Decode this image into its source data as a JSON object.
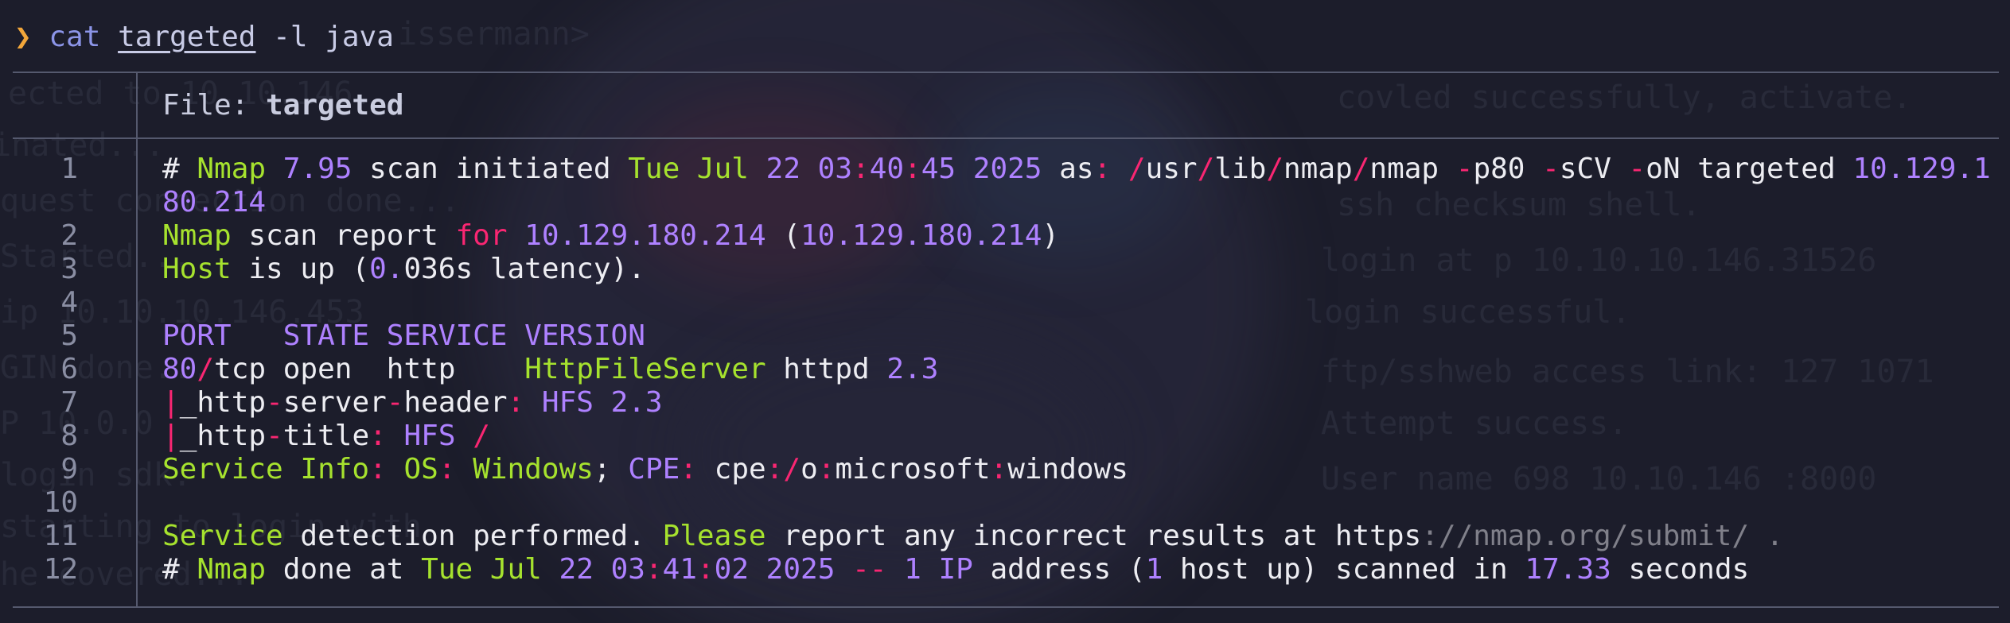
{
  "prompt": {
    "arrow": "❯",
    "command": "cat",
    "file_arg": "targeted",
    "options": "-l java"
  },
  "file_header": {
    "label": "File: ",
    "filename": "targeted"
  },
  "colors": {
    "background": "#1c1d2b",
    "prompt_arrow": "#f2a63a",
    "command": "#8c95e8",
    "plain": "#ededf2",
    "green": "#a6e22e",
    "purple": "#ae81ff",
    "red": "#f92672",
    "grey": "#80808a",
    "rule": "#55596e",
    "line_number": "#8a8ea3"
  },
  "lines": [
    {
      "n": "1",
      "segments": [
        {
          "t": "# ",
          "c": "w"
        },
        {
          "t": "Nmap",
          "c": "g"
        },
        {
          "t": " ",
          "c": "w"
        },
        {
          "t": "7.95",
          "c": "p"
        },
        {
          "t": " scan initiated ",
          "c": "w"
        },
        {
          "t": "Tue Jul",
          "c": "g"
        },
        {
          "t": " ",
          "c": "w"
        },
        {
          "t": "22 03",
          "c": "p"
        },
        {
          "t": ":",
          "c": "r"
        },
        {
          "t": "40",
          "c": "p"
        },
        {
          "t": ":",
          "c": "r"
        },
        {
          "t": "45 2025",
          "c": "p"
        },
        {
          "t": " as",
          "c": "w"
        },
        {
          "t": ":",
          "c": "r"
        },
        {
          "t": " ",
          "c": "w"
        },
        {
          "t": "/",
          "c": "r"
        },
        {
          "t": "usr",
          "c": "w"
        },
        {
          "t": "/",
          "c": "r"
        },
        {
          "t": "lib",
          "c": "w"
        },
        {
          "t": "/",
          "c": "r"
        },
        {
          "t": "nmap",
          "c": "w"
        },
        {
          "t": "/",
          "c": "r"
        },
        {
          "t": "nmap ",
          "c": "w"
        },
        {
          "t": "-",
          "c": "r"
        },
        {
          "t": "p80 ",
          "c": "w"
        },
        {
          "t": "-",
          "c": "r"
        },
        {
          "t": "sCV ",
          "c": "w"
        },
        {
          "t": "-",
          "c": "r"
        },
        {
          "t": "oN targeted ",
          "c": "w"
        },
        {
          "t": "10.129.180.214",
          "c": "p"
        }
      ]
    },
    {
      "n": "2",
      "segments": [
        {
          "t": "Nmap",
          "c": "g"
        },
        {
          "t": " scan report ",
          "c": "w"
        },
        {
          "t": "for",
          "c": "r"
        },
        {
          "t": " ",
          "c": "w"
        },
        {
          "t": "10.129.180.214",
          "c": "p"
        },
        {
          "t": " (",
          "c": "w"
        },
        {
          "t": "10.129.180.214",
          "c": "p"
        },
        {
          "t": ")",
          "c": "w"
        }
      ]
    },
    {
      "n": "3",
      "segments": [
        {
          "t": "Host",
          "c": "g"
        },
        {
          "t": " is up (",
          "c": "w"
        },
        {
          "t": "0.",
          "c": "p"
        },
        {
          "t": "036s latency).",
          "c": "w"
        }
      ]
    },
    {
      "n": "4",
      "segments": []
    },
    {
      "n": "5",
      "segments": [
        {
          "t": "PORT   STATE SERVICE VERSION",
          "c": "p"
        }
      ]
    },
    {
      "n": "6",
      "segments": [
        {
          "t": "80",
          "c": "p"
        },
        {
          "t": "/",
          "c": "r"
        },
        {
          "t": "tcp open  http    ",
          "c": "w"
        },
        {
          "t": "HttpFileServer",
          "c": "g"
        },
        {
          "t": " httpd ",
          "c": "w"
        },
        {
          "t": "2.3",
          "c": "p"
        }
      ]
    },
    {
      "n": "7",
      "segments": [
        {
          "t": "|",
          "c": "r"
        },
        {
          "t": "_http",
          "c": "w"
        },
        {
          "t": "-",
          "c": "r"
        },
        {
          "t": "server",
          "c": "w"
        },
        {
          "t": "-",
          "c": "r"
        },
        {
          "t": "header",
          "c": "w"
        },
        {
          "t": ":",
          "c": "r"
        },
        {
          "t": " HFS 2.3",
          "c": "p"
        }
      ]
    },
    {
      "n": "8",
      "segments": [
        {
          "t": "|",
          "c": "r"
        },
        {
          "t": "_http",
          "c": "w"
        },
        {
          "t": "-",
          "c": "r"
        },
        {
          "t": "title",
          "c": "w"
        },
        {
          "t": ":",
          "c": "r"
        },
        {
          "t": " HFS ",
          "c": "p"
        },
        {
          "t": "/",
          "c": "r"
        }
      ]
    },
    {
      "n": "9",
      "segments": [
        {
          "t": "Service Info",
          "c": "g"
        },
        {
          "t": ":",
          "c": "r"
        },
        {
          "t": " ",
          "c": "w"
        },
        {
          "t": "OS",
          "c": "g"
        },
        {
          "t": ":",
          "c": "r"
        },
        {
          "t": " ",
          "c": "w"
        },
        {
          "t": "Windows",
          "c": "g"
        },
        {
          "t": "; ",
          "c": "w"
        },
        {
          "t": "CPE",
          "c": "p"
        },
        {
          "t": ":",
          "c": "r"
        },
        {
          "t": " cpe",
          "c": "w"
        },
        {
          "t": ":/",
          "c": "r"
        },
        {
          "t": "o",
          "c": "w"
        },
        {
          "t": ":",
          "c": "r"
        },
        {
          "t": "microsoft",
          "c": "w"
        },
        {
          "t": ":",
          "c": "r"
        },
        {
          "t": "windows",
          "c": "w"
        }
      ]
    },
    {
      "n": "10",
      "segments": []
    },
    {
      "n": "11",
      "segments": [
        {
          "t": "Service",
          "c": "g"
        },
        {
          "t": " detection performed. ",
          "c": "w"
        },
        {
          "t": "Please",
          "c": "g"
        },
        {
          "t": " report any incorrect results at https",
          "c": "w"
        },
        {
          "t": "://nmap.org/submit/ .",
          "c": "gy"
        }
      ]
    },
    {
      "n": "12",
      "segments": [
        {
          "t": "# ",
          "c": "w"
        },
        {
          "t": "Nmap",
          "c": "g"
        },
        {
          "t": " done at ",
          "c": "w"
        },
        {
          "t": "Tue Jul",
          "c": "g"
        },
        {
          "t": " ",
          "c": "w"
        },
        {
          "t": "22 03",
          "c": "p"
        },
        {
          "t": ":",
          "c": "r"
        },
        {
          "t": "41",
          "c": "p"
        },
        {
          "t": ":",
          "c": "r"
        },
        {
          "t": "02 2025",
          "c": "p"
        },
        {
          "t": " ",
          "c": "w"
        },
        {
          "t": "--",
          "c": "r"
        },
        {
          "t": " ",
          "c": "w"
        },
        {
          "t": "1 IP",
          "c": "p"
        },
        {
          "t": " address (",
          "c": "w"
        },
        {
          "t": "1",
          "c": "p"
        },
        {
          "t": " host up) scanned in ",
          "c": "w"
        },
        {
          "t": "17.33",
          "c": "p"
        },
        {
          "t": " seconds",
          "c": "w"
        }
      ]
    }
  ]
}
